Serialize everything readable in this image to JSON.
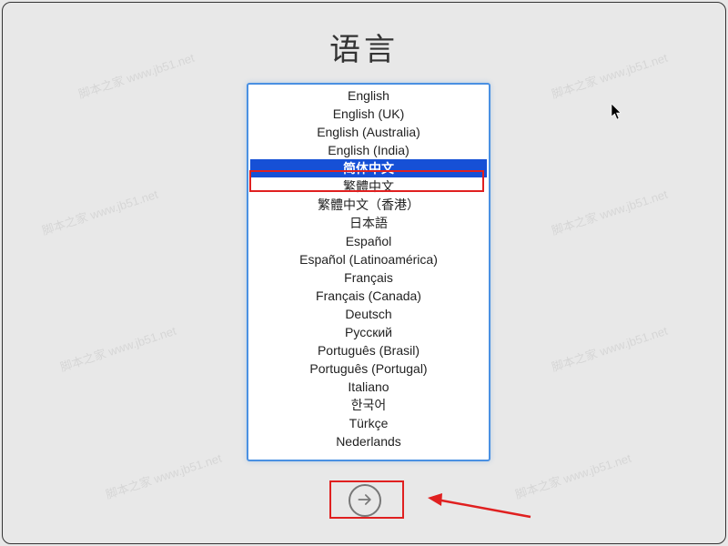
{
  "title": "语言",
  "selected_index": 4,
  "languages": [
    "English",
    "English (UK)",
    "English (Australia)",
    "English (India)",
    "简体中文",
    "繁體中文",
    "繁體中文（香港）",
    "日本語",
    "Español",
    "Español (Latinoamérica)",
    "Français",
    "Français (Canada)",
    "Deutsch",
    "Русский",
    "Português (Brasil)",
    "Português (Portugal)",
    "Italiano",
    "한국어",
    "Türkçe",
    "Nederlands"
  ],
  "watermark_text": "脚本之家  www.jb51.net",
  "colors": {
    "selection": "#1650d6",
    "focus_border": "#4a90e2",
    "highlight": "#e02020"
  }
}
